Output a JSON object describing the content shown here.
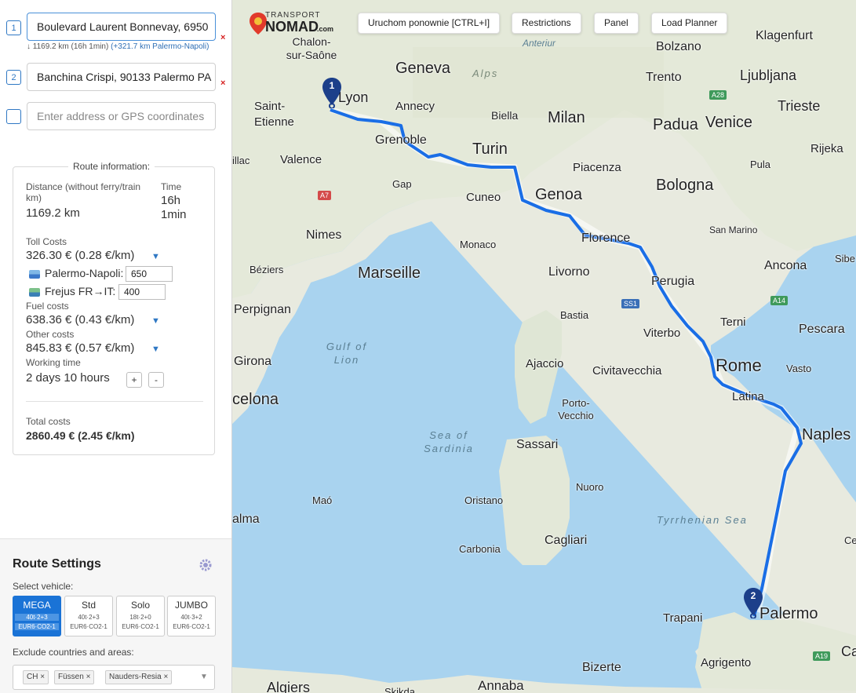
{
  "addresses": [
    {
      "index": "1",
      "value": "Boulevard Laurent Bonnevay, 6950",
      "remove": "×"
    },
    {
      "index": "2",
      "value": "Banchina Crispi, 90133 Palermo PA",
      "remove": "×"
    }
  ],
  "new_address_placeholder": "Enter address or GPS coordinates",
  "segment_summary": {
    "distance": "↓ 1169.2 km (16h 1min)",
    "extra": "(+321.7 km Palermo-Napoli)"
  },
  "route_info": {
    "title": "Route information:",
    "distance_label": "Distance (without ferry/train km)",
    "distance_value": "1169.2 km",
    "time_label": "Time",
    "time_value_1": "16h",
    "time_value_2": "1min",
    "toll_label": "Toll Costs",
    "toll_value": "326.30 € (0.28 €/km)",
    "ferry_1_label": "Palermo-Napoli:",
    "ferry_1_value": "650",
    "ferry_2_label": "Frejus FR→IT:",
    "ferry_2_value": "400",
    "fuel_label": "Fuel costs",
    "fuel_value": "638.36 € (0.43 €/km)",
    "other_label": "Other costs",
    "other_value": "845.83 € (0.57 €/km)",
    "working_label": "Working time",
    "working_value": "2 days 10 hours",
    "plus": "+",
    "minus": "-",
    "total_label": "Total costs",
    "total_value": "2860.49 € (2.45 €/km)",
    "dropdown_glyph": "▼"
  },
  "route_settings": {
    "title": "Route Settings",
    "select_vehicle_label": "Select vehicle:",
    "vehicles": [
      {
        "name": "MEGA",
        "spec": "40t·2+3",
        "emission": "EUR6·CO2-1"
      },
      {
        "name": "Std",
        "spec": "40t·2+3",
        "emission": "EUR6·CO2-1"
      },
      {
        "name": "Solo",
        "spec": "18t·2+0",
        "emission": "EUR6·CO2-1"
      },
      {
        "name": "JUMBO",
        "spec": "40t·3+2",
        "emission": "EUR6·CO2-1"
      }
    ],
    "exclude_label": "Exclude countries and areas:",
    "exclusions": [
      "CH ×",
      "Füssen ×",
      "Nauders-Resia ×"
    ],
    "exclude_dropdown": "▼"
  },
  "map": {
    "logo_top": "TRANSPORT",
    "logo_main": "NOMAD",
    "logo_suffix": ".com",
    "buttons": [
      "Uruchom ponownie [CTRL+I]",
      "Restrictions",
      "Panel",
      "Load Planner"
    ],
    "cities_big": [
      "Geneva",
      "Milan",
      "Turin",
      "Genoa",
      "Bologna",
      "Venice",
      "Padua",
      "Marseille",
      "Florence",
      "Rome",
      "Naples",
      "Palermo",
      "Sassari",
      "Cagliari",
      "Ljubljana",
      "Trieste",
      "Lyon",
      "Grenoble",
      "Nimes",
      "Livorno",
      "Perugia",
      "Ancona",
      "Pescara",
      "Trento",
      "Bolzano",
      "Klagenfurt",
      "Rijeka",
      "Perpignan",
      "Girona",
      "celona",
      "alma",
      "Saint-Etienne",
      "Annecy",
      "Valence",
      "Latina",
      "Terni",
      "Piacenza",
      "Cuneo",
      "Biella",
      "Ajaccio",
      "Civitavecchia",
      "Viterbo",
      "Trapani",
      "Agrigento",
      "Bizerte",
      "Annaba",
      "Algiers"
    ],
    "cities_small": [
      "Chalon-sur-Saône",
      "Gap",
      "Béziers",
      "Monaco",
      "Bastia",
      "Porto-Vecchio",
      "Oristano",
      "Nuoro",
      "Carbonia",
      "Maó",
      "San Marino",
      "Pula",
      "Vasto",
      "Sibe",
      "Skikda",
      "Ca",
      "Cesi",
      "illac"
    ],
    "seas": [
      "Gulf of Lion",
      "Sea of Sardinia",
      "Tyrrhenian Sea",
      "Anteriur",
      "Alps"
    ],
    "roads": [
      "A7",
      "A28",
      "SS1",
      "A14",
      "A19"
    ],
    "markers": [
      "1",
      "2"
    ]
  },
  "colors": {
    "route": "#1a6ee6",
    "sea": "#a9d3ef",
    "land": "#e8eadf",
    "accent": "#1a73d6"
  }
}
